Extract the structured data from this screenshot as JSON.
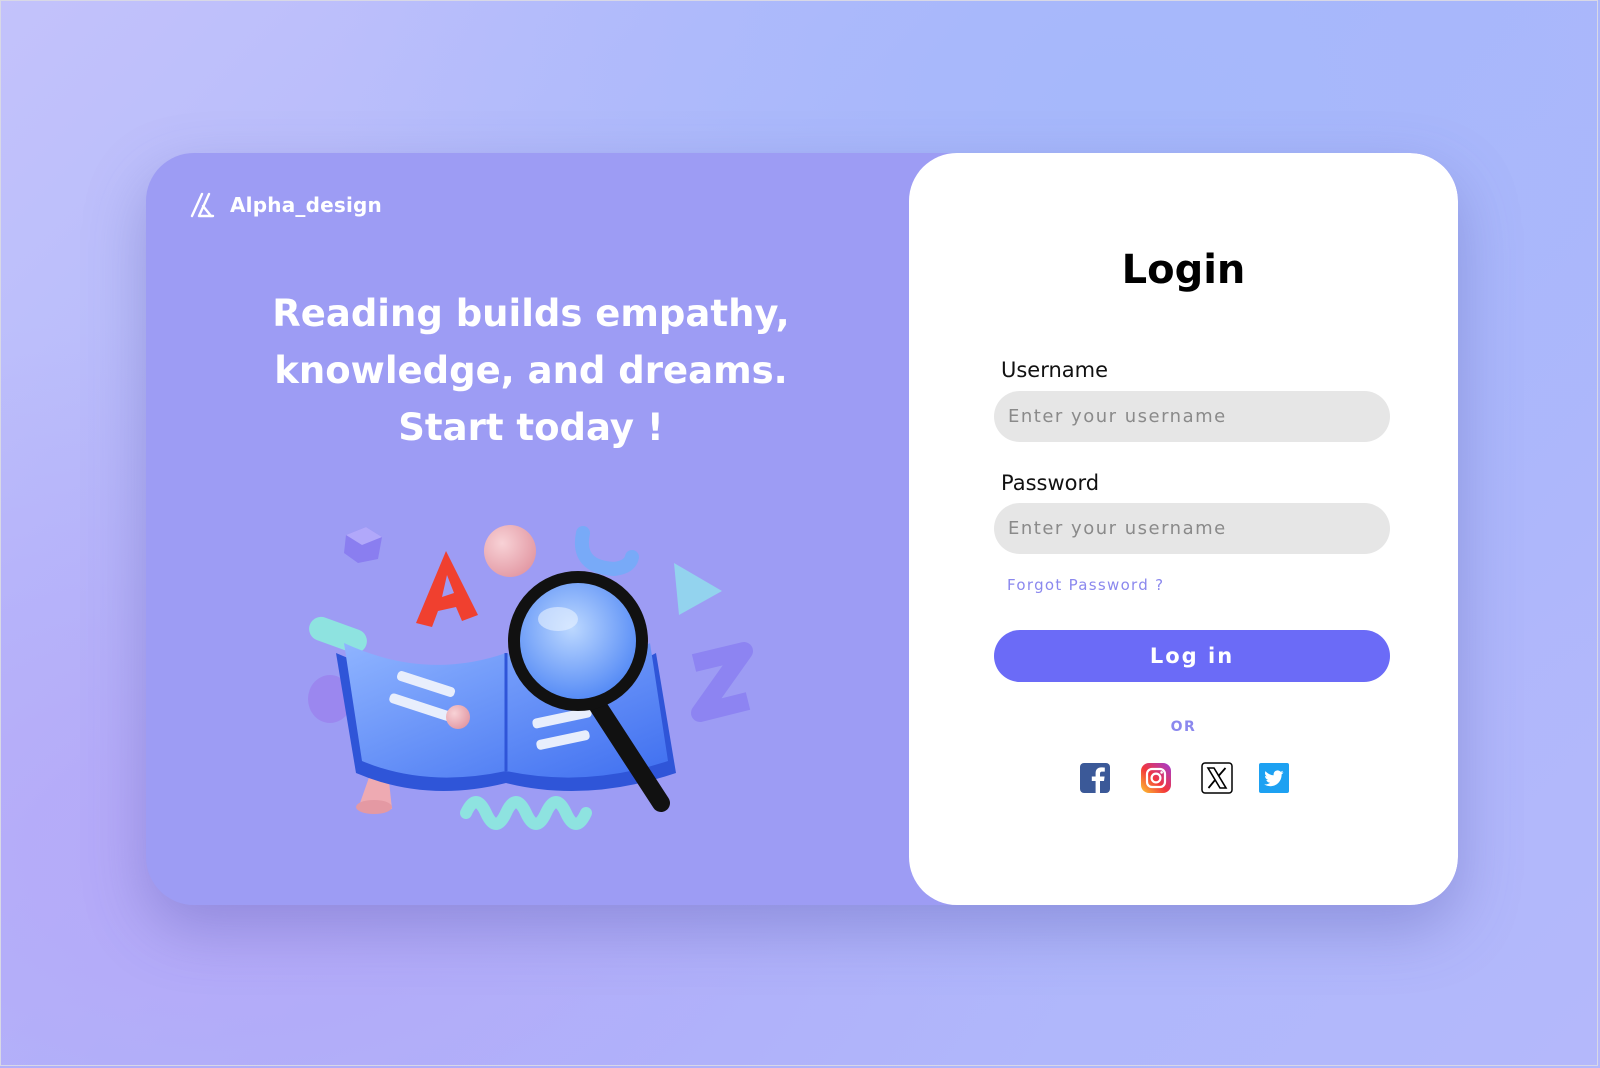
{
  "brand": {
    "name": "Alpha_design",
    "logo_icon": "alpha-design-logo-icon"
  },
  "hero": {
    "lines": [
      "Reading builds empathy,",
      "knowledge, and dreams.",
      "Start today !"
    ],
    "illustration": "open-book-magnifier-illustration"
  },
  "login": {
    "title": "Login",
    "username": {
      "label": "Username",
      "placeholder": "Enter your username",
      "value": ""
    },
    "password": {
      "label": "Password",
      "placeholder": "Enter your username",
      "value": ""
    },
    "forgot_label": "Forgot Password ?",
    "submit_label": "Log in",
    "divider_label": "OR",
    "social": [
      {
        "icon": "facebook-icon",
        "color": "#3b5998"
      },
      {
        "icon": "instagram-icon",
        "color": "#d6249f"
      },
      {
        "icon": "x-icon",
        "color": "#000000"
      },
      {
        "icon": "twitter-icon",
        "color": "#1da1f2"
      }
    ]
  },
  "colors": {
    "accent": "#6b6bf7",
    "left_panel": "#9d9cf4",
    "link": "#8b88ee",
    "input_bg": "#e6e6e6"
  }
}
